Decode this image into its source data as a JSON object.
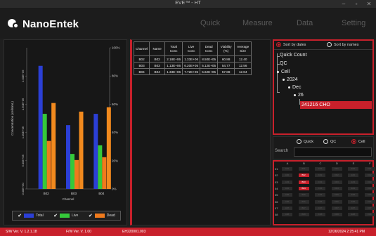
{
  "window": {
    "title": "EVE™ - HT"
  },
  "header": {
    "logo_text": "NanoEntek",
    "tabs": [
      "Quick",
      "Measure",
      "Data",
      "Setting"
    ]
  },
  "table": {
    "headers": [
      "Channel",
      "Name",
      "Total Conc",
      "Live Conc",
      "Dead Conc",
      "Viability (%)",
      "Average Size"
    ],
    "rows": [
      [
        "B02",
        "B02",
        "2.18E+06",
        "1.33E+06",
        "8.50E+05",
        "60.88",
        "12.40"
      ],
      [
        "B03",
        "B03",
        "1.13E+06",
        "6.20E+05",
        "5.12E+05",
        "54.77",
        "12.56"
      ],
      [
        "B04",
        "B04",
        "1.33E+06",
        "7.72E+05",
        "5.62E+05",
        "57.88",
        "12.84"
      ]
    ]
  },
  "sort": {
    "by_dates": "Sort by dates",
    "by_names": "Sort by names",
    "selected": "dates"
  },
  "tree": {
    "items": [
      "Quick Count",
      "QC",
      "Cell",
      "2024",
      "Dec",
      "26",
      "241216 CHO"
    ]
  },
  "filter": {
    "options": [
      "Quick",
      "QC",
      "Cell"
    ],
    "selected": "Cell",
    "search_label": "Search",
    "search_value": ""
  },
  "plate": {
    "columns": [
      "A",
      "B",
      "C",
      "D",
      "E",
      "F"
    ],
    "rows": [
      "01",
      "02",
      "03",
      "04",
      "05",
      "06",
      "07",
      "08"
    ],
    "active_wells": [
      "B02",
      "B03",
      "B04"
    ]
  },
  "legend": {
    "items": [
      "Total",
      "Live",
      "Dead"
    ]
  },
  "colors": {
    "accent": "#c8202b",
    "total": "#2b3fd6",
    "live": "#35c93a",
    "dead": "#f07a1c"
  },
  "status": {
    "sw_ver": "S/W Ver. V. 1.2.1.18",
    "fw_ver": "F/W Ver. V. 1.00",
    "device_id": "EH220001.003",
    "datetime": "12/26/2024 2:25:41 PM"
  },
  "chart_data": {
    "type": "bar",
    "categories": [
      "B02",
      "B03",
      "B04"
    ],
    "series": [
      {
        "name": "Total",
        "values": [
          2180000.0,
          1130000.0,
          1330000.0
        ]
      },
      {
        "name": "Live",
        "values": [
          1330000.0,
          620000.0,
          772000.0
        ]
      },
      {
        "name": "Dead",
        "values": [
          850000.0,
          512000.0,
          562000.0
        ]
      },
      {
        "name": "Viability",
        "axis": "right",
        "values": [
          60.88,
          54.77,
          57.88
        ]
      }
    ],
    "xlabel": "Channel",
    "ylabel": "Concentration (cells/mL)",
    "ylim": [
      0,
      2500000.0
    ],
    "y_ticks": [
      "0.00E+00",
      "5.00E+05",
      "1.00E+06",
      "1.50E+06",
      "2.00E+06"
    ],
    "y2lim": [
      0,
      100
    ],
    "y2_ticks": [
      "0%",
      "20%",
      "40%",
      "60%",
      "80%",
      "100%"
    ],
    "grid": false,
    "legend_position": "bottom"
  }
}
